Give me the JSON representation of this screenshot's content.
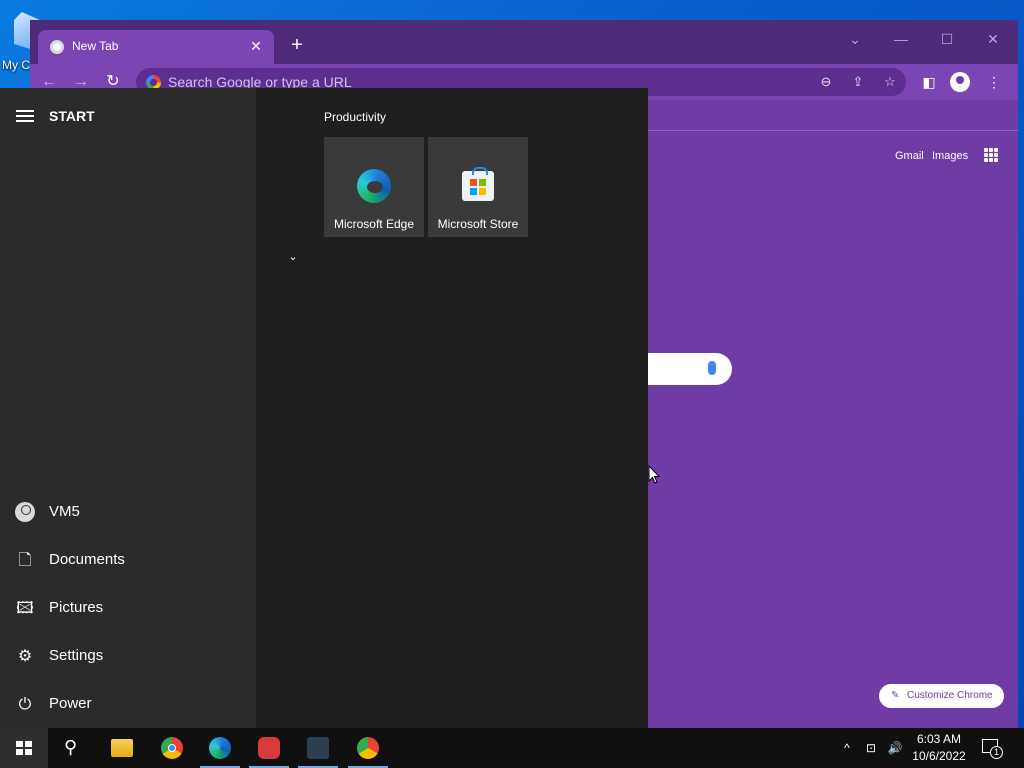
{
  "desktop": {
    "icon_label": "My C"
  },
  "chrome": {
    "tab": {
      "title": "New Tab",
      "close": "✕"
    },
    "new_tab": "+",
    "window_controls": {
      "dropdown": "⌄",
      "minimize": "—",
      "maximize": "☐",
      "close": "✕"
    },
    "nav": {
      "back": "←",
      "forward": "→",
      "reload": "↻"
    },
    "omnibox": {
      "placeholder": "Search Google or type a URL"
    },
    "omnibox_icons": {
      "zoom": "⊖",
      "share": "⇪",
      "bookmark": "☆"
    },
    "toolbar_icons": {
      "side_panel": "◧",
      "menu": "⋮"
    },
    "ntp": {
      "gmail": "Gmail",
      "images": "Images",
      "customize": "Customize Chrome",
      "customize_icon": "✎"
    }
  },
  "start_menu": {
    "title": "START",
    "sidebar": [
      {
        "label": "VM5",
        "icon": "user-avatar"
      },
      {
        "label": "Documents",
        "icon": "document-icon",
        "glyph": "🗋"
      },
      {
        "label": "Pictures",
        "icon": "pictures-icon",
        "glyph": "🖾"
      },
      {
        "label": "Settings",
        "icon": "gear-icon",
        "glyph": "⚙"
      },
      {
        "label": "Power",
        "icon": "power-icon",
        "glyph": "⏻"
      }
    ],
    "group": {
      "title": "Productivity",
      "tiles": [
        {
          "label": "Microsoft Edge",
          "icon": "edge-icon"
        },
        {
          "label": "Microsoft Store",
          "icon": "store-icon"
        }
      ]
    },
    "collapse_chevron": "⌄"
  },
  "taskbar": {
    "apps": [
      {
        "name": "search",
        "glyph": "⚲"
      },
      {
        "name": "file-explorer"
      },
      {
        "name": "chrome"
      },
      {
        "name": "edge"
      },
      {
        "name": "app-red"
      },
      {
        "name": "app-dark"
      },
      {
        "name": "chrome-profile"
      }
    ],
    "tray": {
      "chevron": "^",
      "network": "⊡",
      "volume": "🔊"
    },
    "clock": {
      "time": "6:03 AM",
      "date": "10/6/2022"
    },
    "notifications": {
      "count": "1"
    }
  },
  "colors": {
    "chrome_theme": "#6f3ca6",
    "start_bg": "#1f1f1f",
    "taskbar_bg": "#101010",
    "accent": "#0078d4"
  }
}
